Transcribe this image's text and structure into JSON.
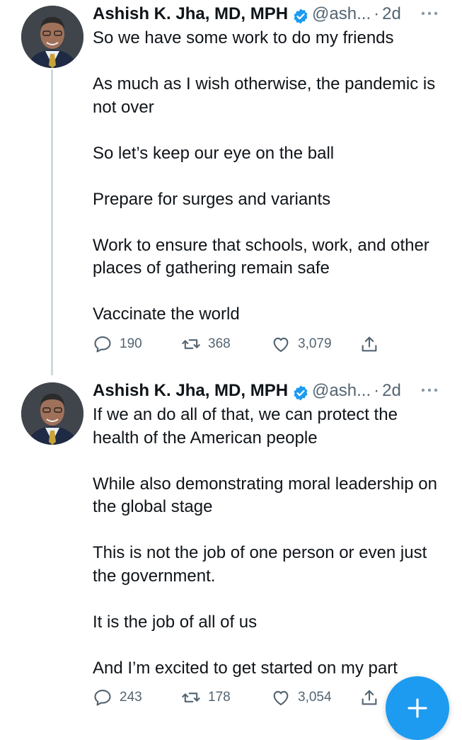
{
  "tweets": [
    {
      "author_name": "Ashish K. Jha, MD, MPH",
      "handle": "@ash...",
      "separator": "·",
      "time": "2d",
      "paragraphs": [
        "So we have some work to do my friends",
        "As much as I wish otherwise, the pandemic is not over",
        "So let’s keep our eye on the ball",
        "Prepare for surges and variants",
        "Work to ensure that schools, work, and other places of gathering remain safe",
        "Vaccinate the world"
      ],
      "replies": "190",
      "retweets": "368",
      "likes": "3,079"
    },
    {
      "author_name": "Ashish K. Jha, MD, MPH",
      "handle": "@ash...",
      "separator": "·",
      "time": "2d",
      "paragraphs": [
        "If we an do all of that, we can protect the health of the American people",
        "While also demonstrating moral leadership on the global stage",
        "This is not the job of one person or even just the government.",
        "It is the job of all of us",
        "And I’m excited to get started on my part"
      ],
      "replies": "243",
      "retweets": "178",
      "likes": "3,054"
    }
  ],
  "colors": {
    "accent": "#1d9bf0",
    "muted": "#536471",
    "text": "#0f1419",
    "thread": "#cfd9de"
  },
  "icons": [
    "verified-badge-icon",
    "more-icon",
    "reply-icon",
    "retweet-icon",
    "like-icon",
    "share-icon",
    "compose-plus-icon"
  ]
}
